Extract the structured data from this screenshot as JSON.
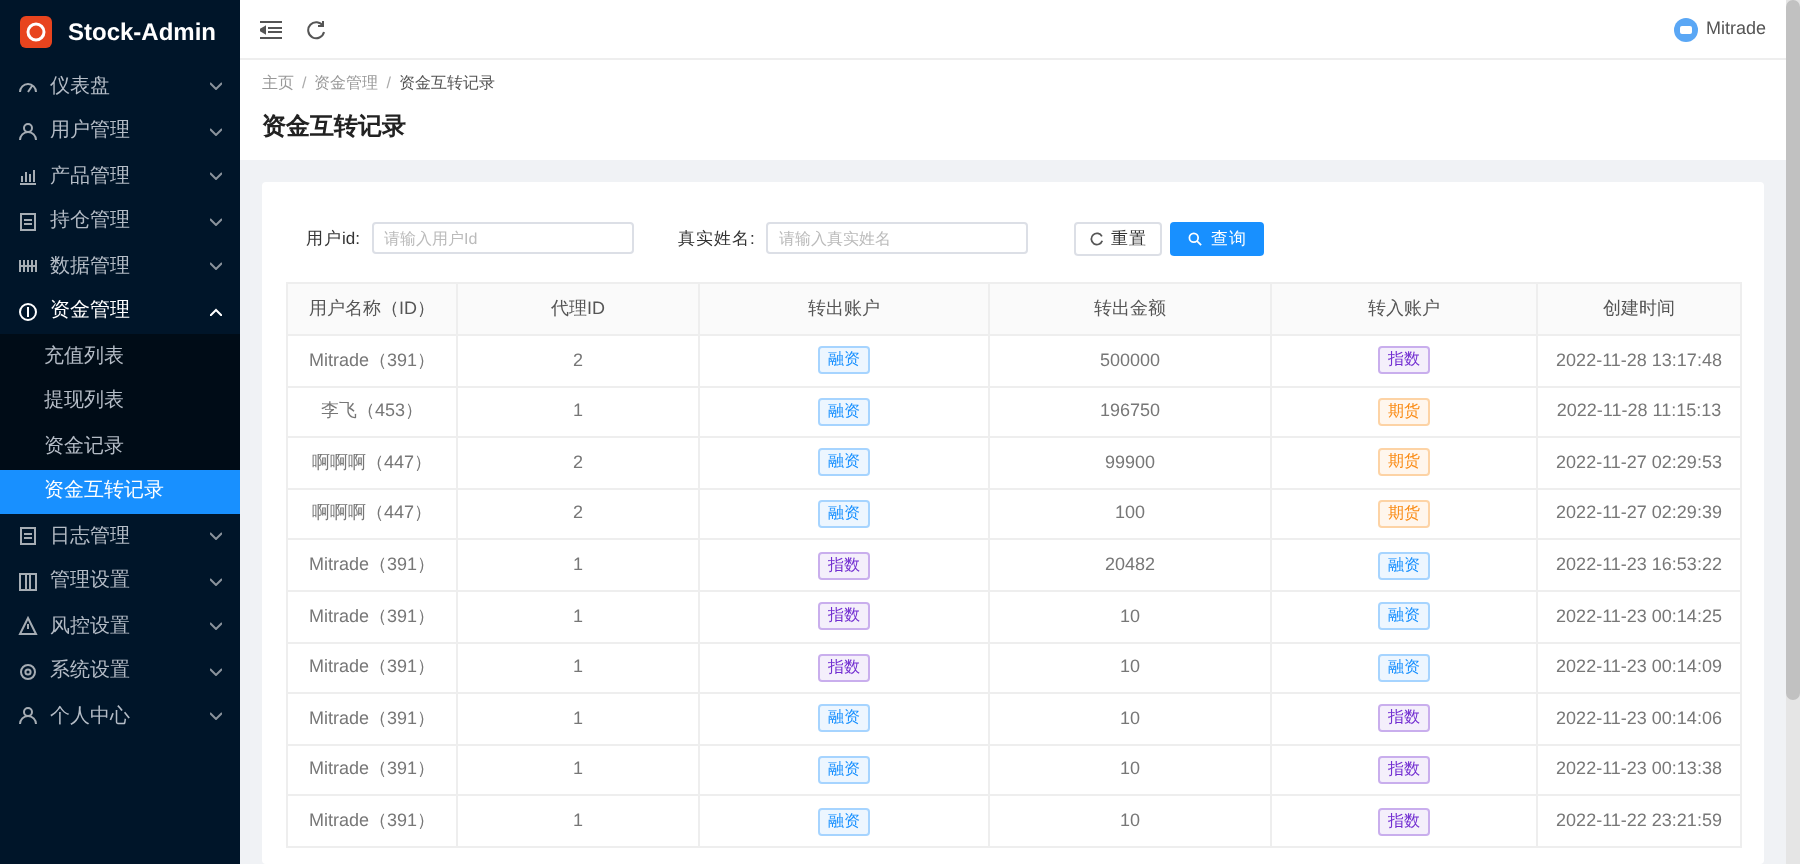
{
  "brand": "Stock-Admin",
  "sidebar": {
    "items": [
      {
        "label": "仪表盘",
        "expanded": false
      },
      {
        "label": "用户管理",
        "expanded": false
      },
      {
        "label": "产品管理",
        "expanded": false
      },
      {
        "label": "持仓管理",
        "expanded": false
      },
      {
        "label": "数据管理",
        "expanded": false
      },
      {
        "label": "资金管理",
        "expanded": true,
        "children": [
          {
            "label": "充值列表",
            "selected": false
          },
          {
            "label": "提现列表",
            "selected": false
          },
          {
            "label": "资金记录",
            "selected": false
          },
          {
            "label": "资金互转记录",
            "selected": true
          }
        ]
      },
      {
        "label": "日志管理",
        "expanded": false
      },
      {
        "label": "管理设置",
        "expanded": false
      },
      {
        "label": "风控设置",
        "expanded": false
      },
      {
        "label": "系统设置",
        "expanded": false
      },
      {
        "label": "个人中心",
        "expanded": false
      }
    ]
  },
  "header": {
    "user": "Mitrade"
  },
  "breadcrumb": [
    {
      "kind": "link",
      "text": "主页"
    },
    {
      "kind": "separator",
      "text": "/"
    },
    {
      "kind": "link",
      "text": "资金管理"
    },
    {
      "kind": "separator",
      "text": "/"
    },
    {
      "kind": "current",
      "text": "资金互转记录"
    }
  ],
  "page_title": "资金互转记录",
  "filters": [
    {
      "label": "用户id:",
      "placeholder": "请输入用户Id"
    },
    {
      "label": "真实姓名:",
      "placeholder": "请输入真实姓名"
    }
  ],
  "buttons": {
    "reset": "重置",
    "search": "查询"
  },
  "table": {
    "columns": [
      "用户名称（ID）",
      "代理ID",
      "转出账户",
      "转出金额",
      "转入账户",
      "创建时间"
    ],
    "rows": [
      {
        "user": "Mitrade（391）",
        "agent": "2",
        "from": {
          "text": "融资",
          "color": "#1890ff"
        },
        "amount": "500000",
        "to": {
          "text": "指数",
          "color": "#722ed1"
        },
        "time": "2022-11-28 13:17:48"
      },
      {
        "user": "李飞（453）",
        "agent": "1",
        "from": {
          "text": "融资",
          "color": "#1890ff"
        },
        "amount": "196750",
        "to": {
          "text": "期货",
          "color": "#fa8c16"
        },
        "time": "2022-11-28 11:15:13"
      },
      {
        "user": "啊啊啊（447）",
        "agent": "2",
        "from": {
          "text": "融资",
          "color": "#1890ff"
        },
        "amount": "99900",
        "to": {
          "text": "期货",
          "color": "#fa8c16"
        },
        "time": "2022-11-27 02:29:53"
      },
      {
        "user": "啊啊啊（447）",
        "agent": "2",
        "from": {
          "text": "融资",
          "color": "#1890ff"
        },
        "amount": "100",
        "to": {
          "text": "期货",
          "color": "#fa8c16"
        },
        "time": "2022-11-27 02:29:39"
      },
      {
        "user": "Mitrade（391）",
        "agent": "1",
        "from": {
          "text": "指数",
          "color": "#722ed1"
        },
        "amount": "20482",
        "to": {
          "text": "融资",
          "color": "#1890ff"
        },
        "time": "2022-11-23 16:53:22"
      },
      {
        "user": "Mitrade（391）",
        "agent": "1",
        "from": {
          "text": "指数",
          "color": "#722ed1"
        },
        "amount": "10",
        "to": {
          "text": "融资",
          "color": "#1890ff"
        },
        "time": "2022-11-23 00:14:25"
      },
      {
        "user": "Mitrade（391）",
        "agent": "1",
        "from": {
          "text": "指数",
          "color": "#722ed1"
        },
        "amount": "10",
        "to": {
          "text": "融资",
          "color": "#1890ff"
        },
        "time": "2022-11-23 00:14:09"
      },
      {
        "user": "Mitrade（391）",
        "agent": "1",
        "from": {
          "text": "融资",
          "color": "#1890ff"
        },
        "amount": "10",
        "to": {
          "text": "指数",
          "color": "#722ed1"
        },
        "time": "2022-11-23 00:14:06"
      },
      {
        "user": "Mitrade（391）",
        "agent": "1",
        "from": {
          "text": "融资",
          "color": "#1890ff"
        },
        "amount": "10",
        "to": {
          "text": "指数",
          "color": "#722ed1"
        },
        "time": "2022-11-23 00:13:38"
      },
      {
        "user": "Mitrade（391）",
        "agent": "1",
        "from": {
          "text": "融资",
          "color": "#1890ff"
        },
        "amount": "10",
        "to": {
          "text": "指数",
          "color": "#722ed1"
        },
        "time": "2022-11-22 23:21:59"
      }
    ]
  }
}
